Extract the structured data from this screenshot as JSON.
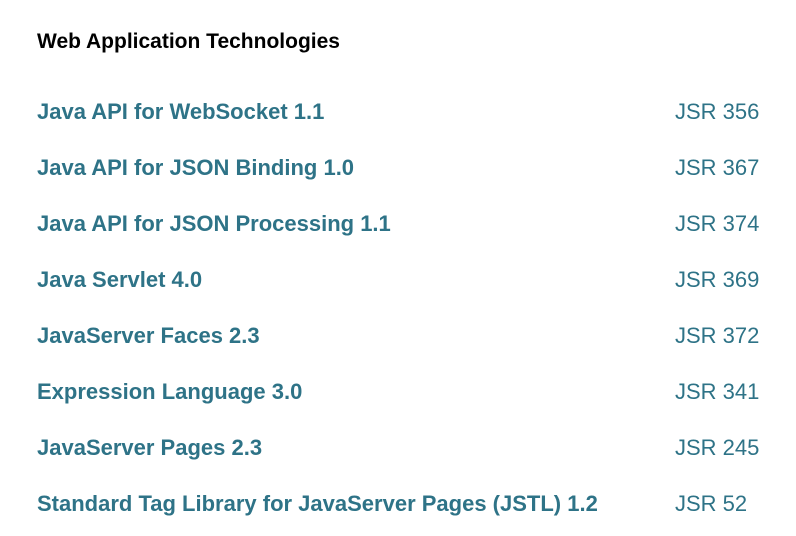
{
  "section": {
    "title": "Web Application Technologies"
  },
  "technologies": [
    {
      "name": "Java API for WebSocket 1.1",
      "jsr": "JSR 356"
    },
    {
      "name": "Java API for JSON Binding 1.0",
      "jsr": "JSR 367"
    },
    {
      "name": "Java API for JSON Processing 1.1",
      "jsr": "JSR 374"
    },
    {
      "name": "Java Servlet 4.0",
      "jsr": "JSR 369"
    },
    {
      "name": "JavaServer Faces 2.3",
      "jsr": "JSR 372"
    },
    {
      "name": "Expression Language 3.0",
      "jsr": "JSR 341"
    },
    {
      "name": "JavaServer Pages 2.3",
      "jsr": "JSR 245"
    },
    {
      "name": "Standard Tag Library for JavaServer Pages (JSTL) 1.2",
      "jsr": "JSR 52"
    }
  ],
  "colors": {
    "link": "#2e7387",
    "heading": "#000000",
    "background": "#ffffff"
  }
}
